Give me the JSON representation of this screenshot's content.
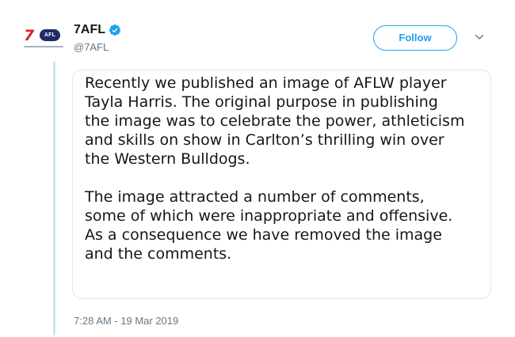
{
  "account": {
    "display_name": "7AFL",
    "handle": "@7AFL",
    "avatar_seven": "7",
    "avatar_badge": "AFL"
  },
  "actions": {
    "follow_label": "Follow",
    "accent_color": "#1da1f2"
  },
  "tweet": {
    "paragraphs": [
      "Recently we published an image of AFLW player\nTayla Harris. The original purpose in publishing\nthe image was to celebrate the power, athleticism\nand skills on show in Carlton’s thrilling win over\nthe Western Bulldogs.",
      "The image attracted a number of comments,\nsome of which were inappropriate and offensive.\nAs a consequence we have removed the image\nand the comments."
    ],
    "timestamp": "7:28 AM - 19 Mar 2019"
  },
  "icons": {
    "verified": "verified-badge-icon",
    "caret": "chevron-down-icon"
  }
}
